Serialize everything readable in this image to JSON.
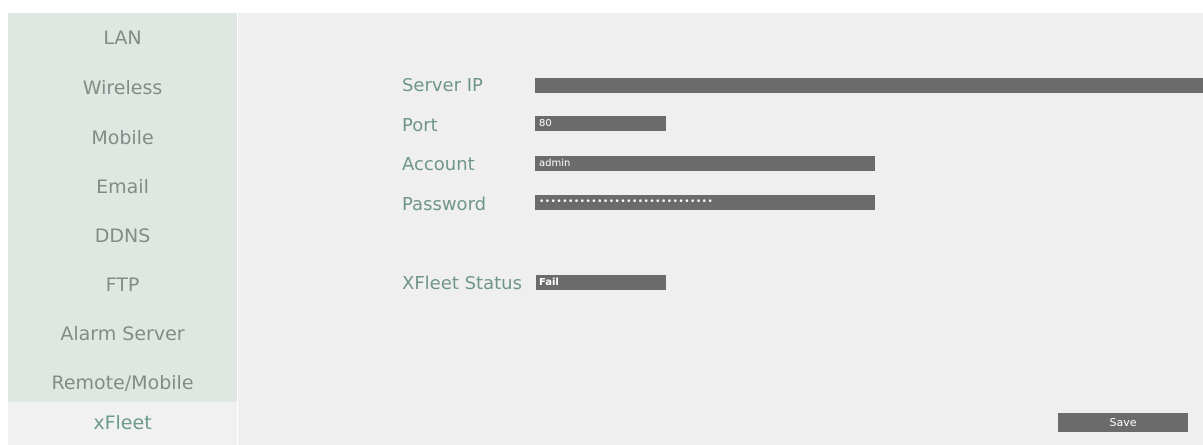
{
  "sidebar": {
    "items": [
      {
        "label": "LAN"
      },
      {
        "label": "Wireless"
      },
      {
        "label": "Mobile"
      },
      {
        "label": "Email"
      },
      {
        "label": "DDNS"
      },
      {
        "label": "FTP"
      },
      {
        "label": "Alarm Server"
      },
      {
        "label": "Remote/Mobile"
      },
      {
        "label": "xFleet",
        "active": true
      }
    ]
  },
  "form": {
    "server_ip_label": "Server IP",
    "server_ip_value": "",
    "port_label": "Port",
    "port_value": "80",
    "account_label": "Account",
    "account_value": "admin",
    "password_label": "Password",
    "password_value": "••••••••••••••••••••••••••••••",
    "status_label": "XFleet Status",
    "status_value": "Fail"
  },
  "actions": {
    "save_label": "Save"
  },
  "colors": {
    "sidebar_bg": "#dfe7e2",
    "sidebar_active_bg": "#f1f1f1",
    "sidebar_text": "#838b87",
    "label_text": "#6f958a",
    "field_bg": "#6b6b6b"
  }
}
